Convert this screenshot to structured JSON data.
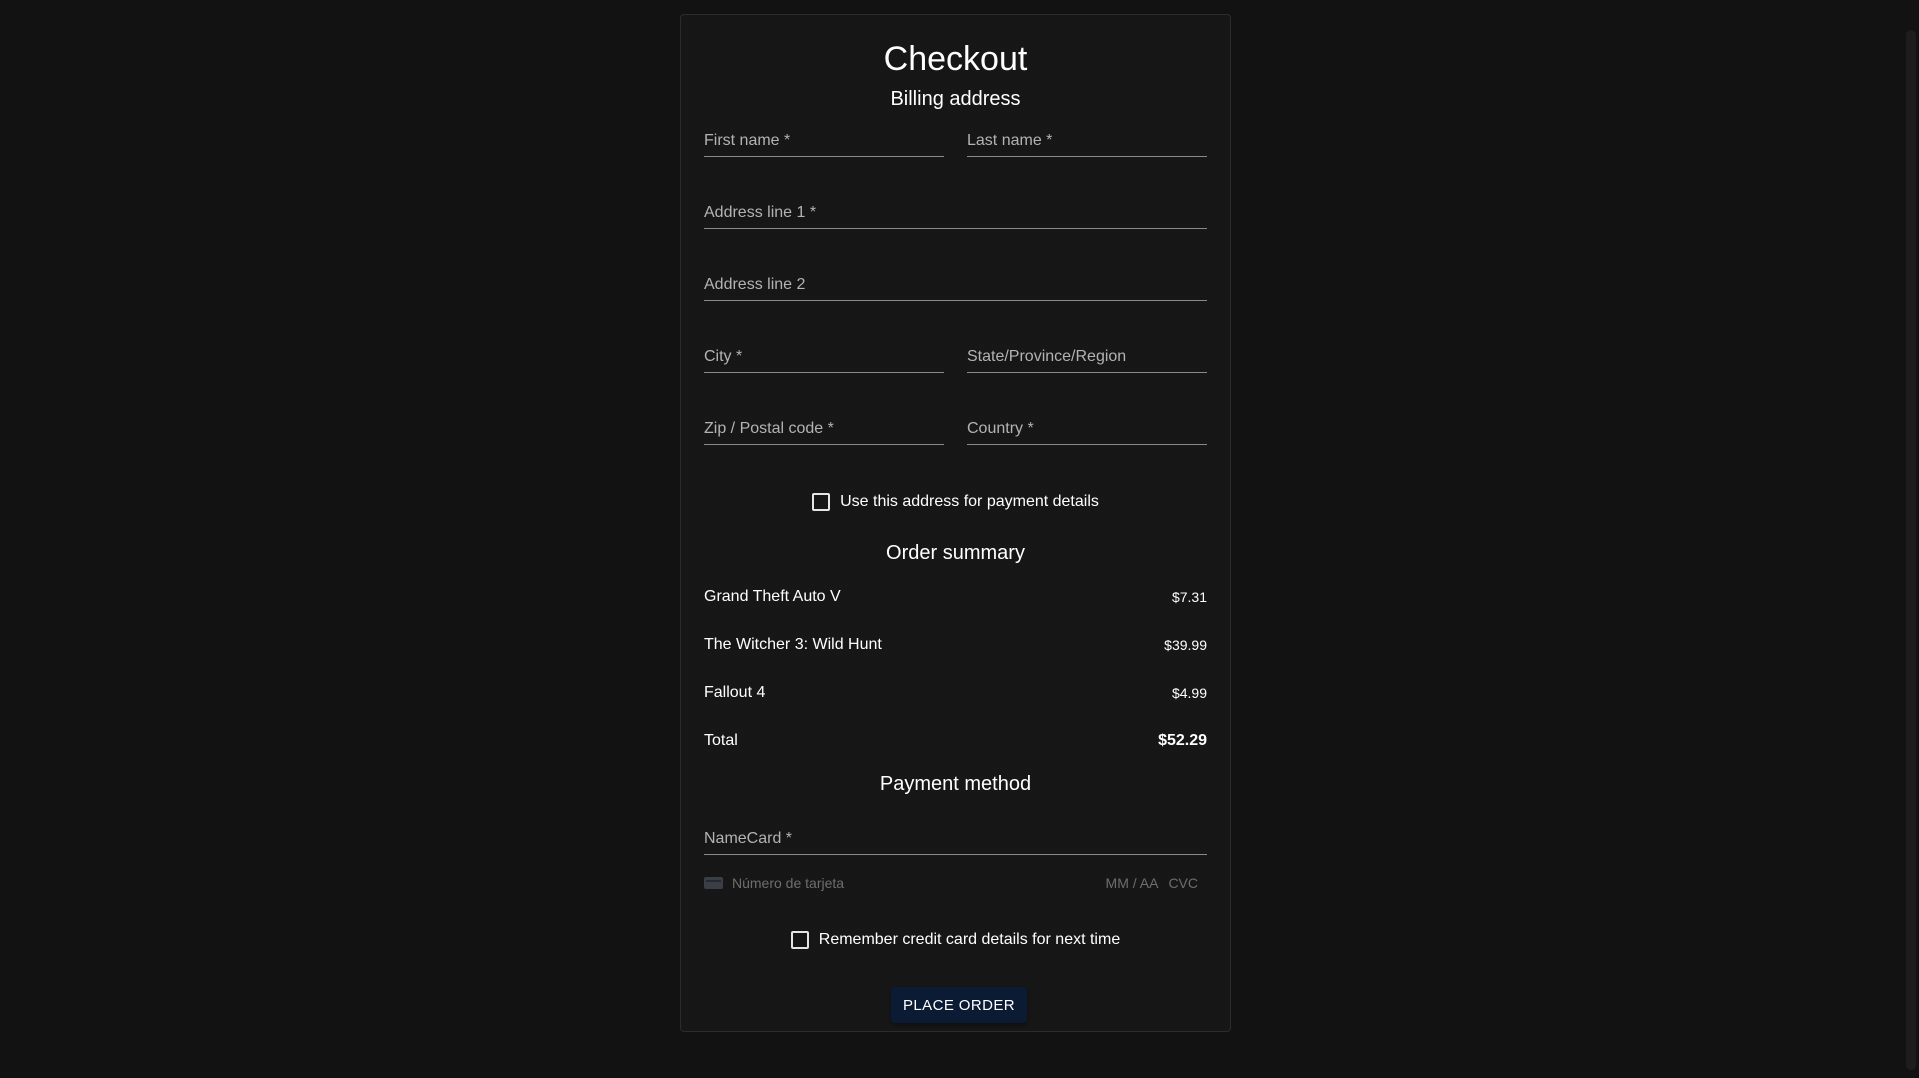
{
  "checkout": {
    "title": "Checkout",
    "subtitle": "Billing address"
  },
  "billing": {
    "first_name_label": "First name *",
    "last_name_label": "Last name *",
    "address1_label": "Address line 1 *",
    "address2_label": "Address line 2",
    "city_label": "City *",
    "state_label": "State/Province/Region",
    "zip_label": "Zip / Postal code *",
    "country_label": "Country *",
    "use_address_label": "Use this address for payment details"
  },
  "summary": {
    "title": "Order summary",
    "items": [
      {
        "name": "Grand Theft Auto V",
        "price": "$7.31"
      },
      {
        "name": "The Witcher 3: Wild Hunt",
        "price": "$39.99"
      },
      {
        "name": "Fallout 4",
        "price": "$4.99"
      }
    ],
    "total_label": "Total",
    "total_value": "$52.29"
  },
  "payment": {
    "title": "Payment method",
    "namecard_label": "NameCard *",
    "card_icon": "credit-card-icon",
    "card_number_placeholder": "Número de tarjeta",
    "expiry_placeholder": "MM / AA",
    "cvc_placeholder": "CVC",
    "remember_label": "Remember credit card details for next time",
    "place_order_label": "PLACE ORDER"
  },
  "colors": {
    "background": "#121212",
    "button": "#0c1b34",
    "underline": "#8a8a8a"
  }
}
